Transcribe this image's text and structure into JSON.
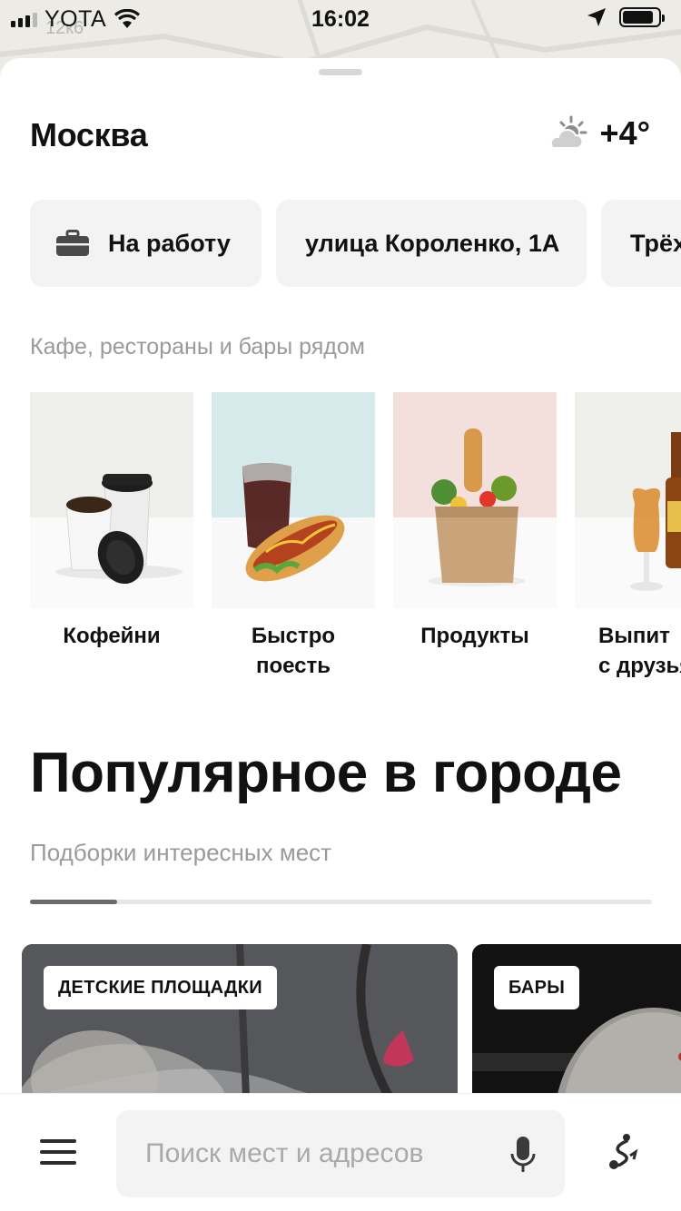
{
  "status_bar": {
    "carrier": "YOTA",
    "time": "16:02"
  },
  "map": {
    "label": "12к6"
  },
  "header": {
    "city": "Москва",
    "temperature": "+4°",
    "weather_icon": "partly-cloudy-icon"
  },
  "quick_routes": [
    {
      "label": "На работу",
      "icon": "briefcase-icon"
    },
    {
      "label": "улица Короленко, 1А"
    },
    {
      "label": "Трёх"
    }
  ],
  "nearby": {
    "title": "Кафе, рестораны и бары рядом",
    "categories": [
      {
        "label": "Кофейни"
      },
      {
        "label": "Быстро поесть"
      },
      {
        "label": "Продукты"
      },
      {
        "label": "Выпит\nс друзья"
      }
    ]
  },
  "popular": {
    "title": "Популярное в городе",
    "subtitle": "Подборки интересных мест",
    "carousel_progress": 0.14,
    "cards": [
      {
        "tag": "ДЕТСКИЕ ПЛОЩАДКИ"
      },
      {
        "tag": "БАРЫ"
      }
    ]
  },
  "bottom_bar": {
    "search_placeholder": "Поиск мест и адресов",
    "icons": [
      "menu-icon",
      "microphone-icon",
      "route-icon"
    ]
  },
  "colors": {
    "sheet": "#ffffff",
    "chip_bg": "#f3f3f3",
    "muted_text": "#9a9a9a",
    "primary_text": "#111111"
  }
}
